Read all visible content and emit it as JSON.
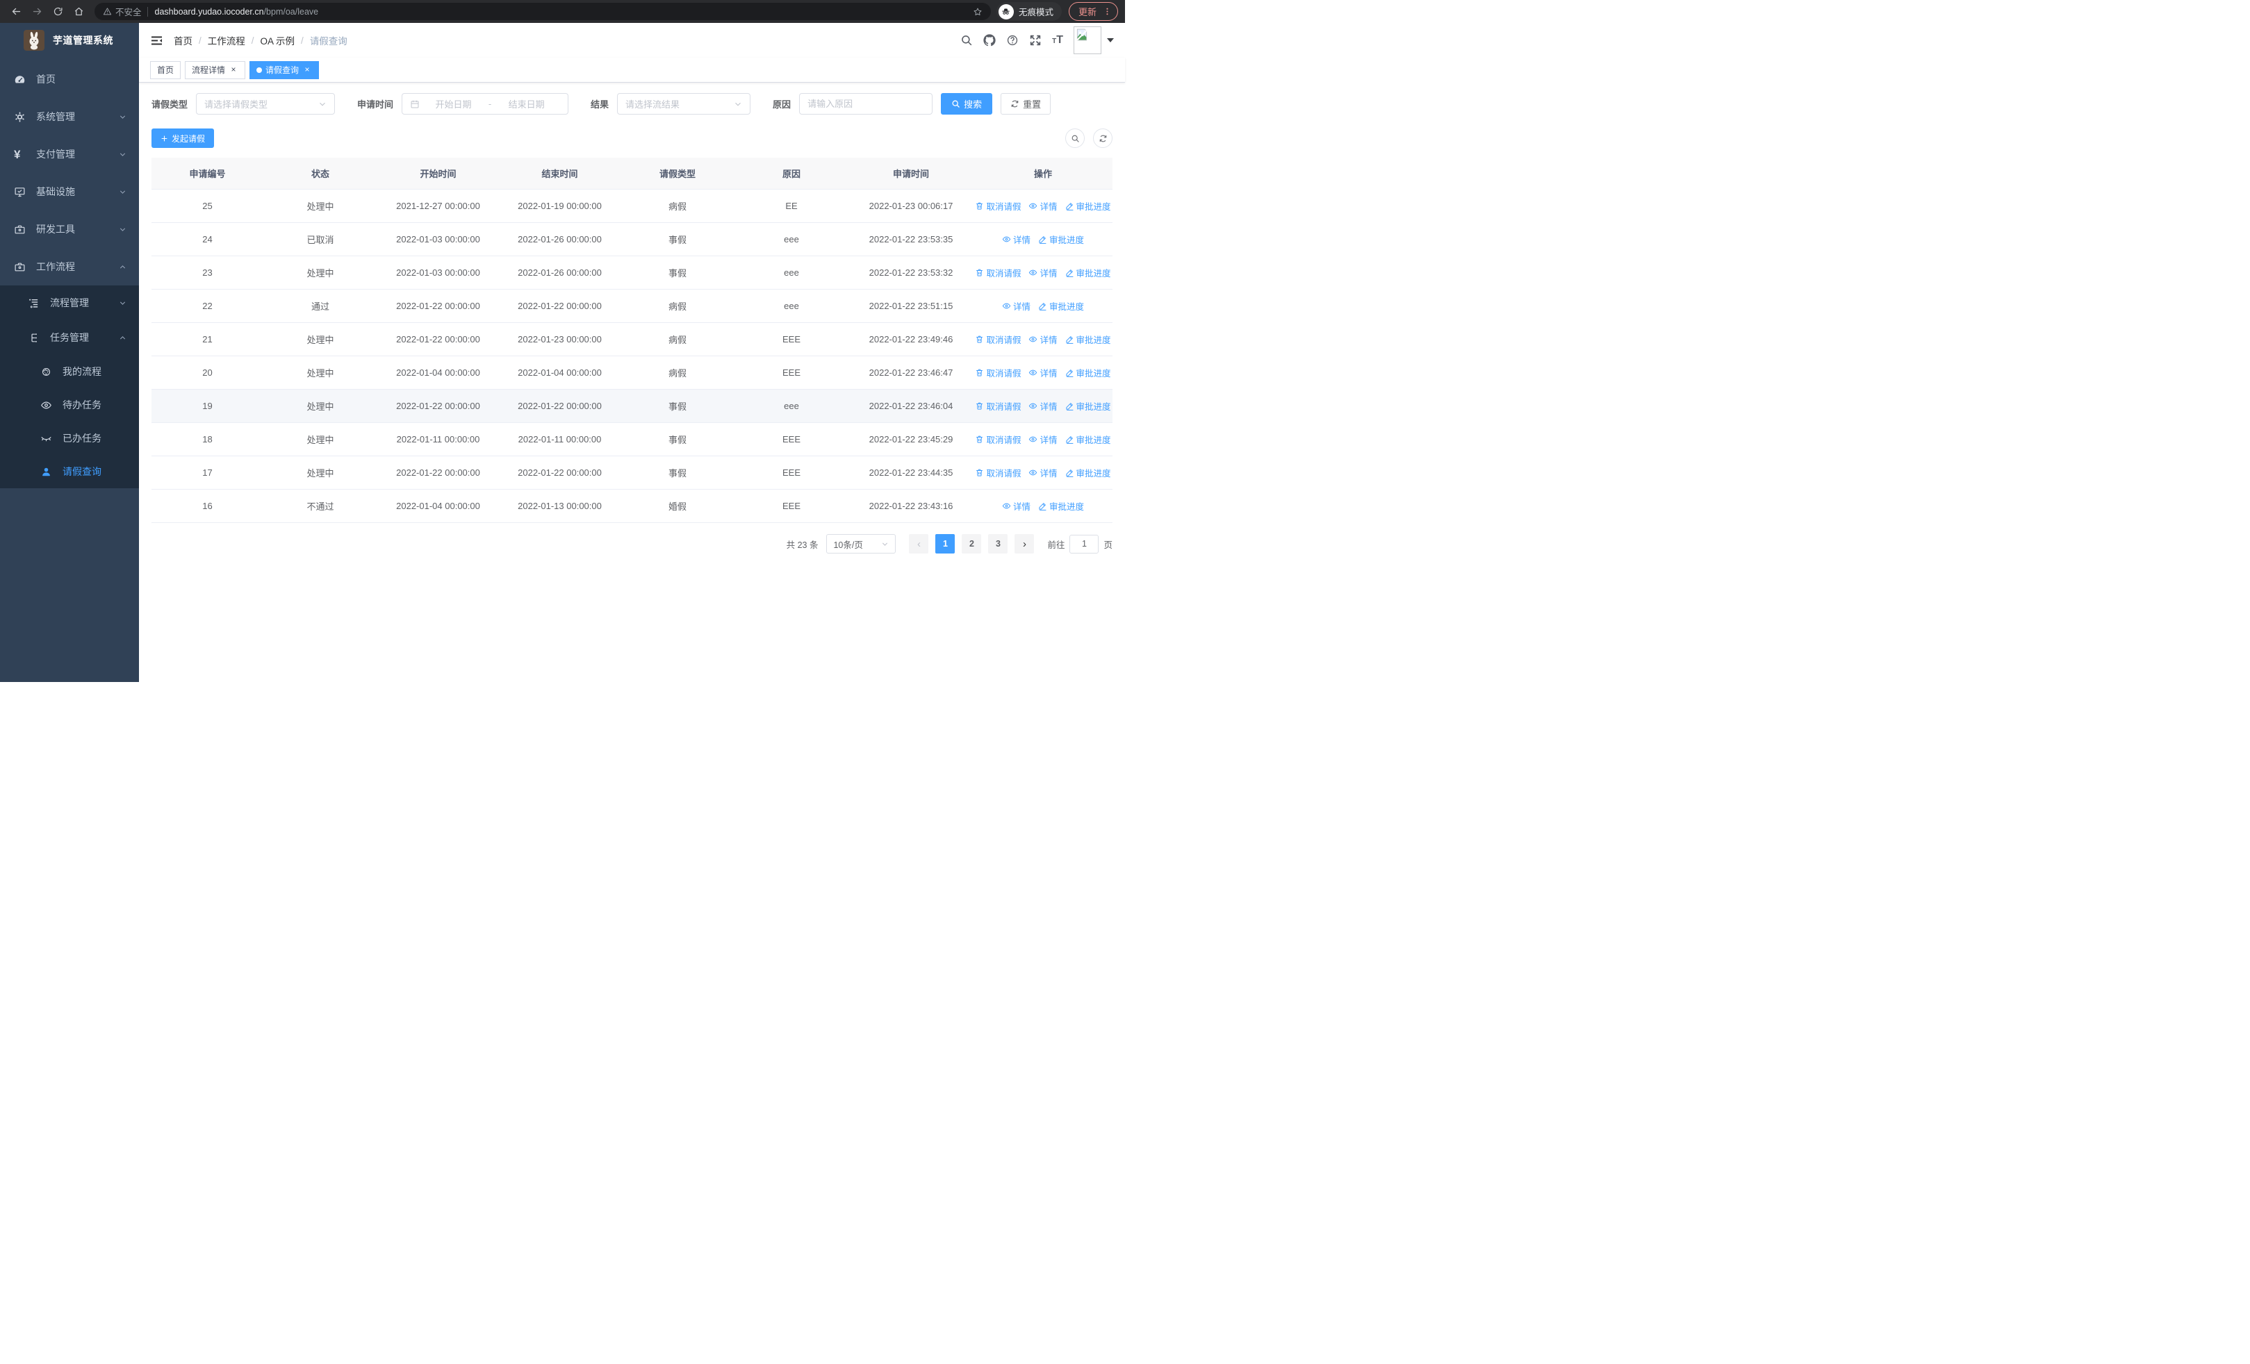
{
  "browser": {
    "security_label": "不安全",
    "url_host": "dashboard.yudao.iocoder.cn",
    "url_path": "/bpm/oa/leave",
    "incognito_label": "无痕模式",
    "update_label": "更新"
  },
  "sidebar": {
    "title": "芋道管理系统",
    "items": [
      {
        "label": "首页"
      },
      {
        "label": "系统管理"
      },
      {
        "label": "支付管理"
      },
      {
        "label": "基础设施"
      },
      {
        "label": "研发工具"
      },
      {
        "label": "工作流程"
      },
      {
        "label": "流程管理"
      },
      {
        "label": "任务管理"
      },
      {
        "label": "我的流程"
      },
      {
        "label": "待办任务"
      },
      {
        "label": "已办任务"
      },
      {
        "label": "请假查询"
      }
    ]
  },
  "navbar": {
    "breadcrumb": [
      "首页",
      "工作流程",
      "OA 示例",
      "请假查询"
    ]
  },
  "tabs": [
    {
      "label": "首页",
      "closable": false,
      "active": false
    },
    {
      "label": "流程详情",
      "closable": true,
      "active": false
    },
    {
      "label": "请假查询",
      "closable": true,
      "active": true
    }
  ],
  "filters": {
    "type_label": "请假类型",
    "type_placeholder": "请选择请假类型",
    "time_label": "申请时间",
    "time_start_placeholder": "开始日期",
    "time_separator": "-",
    "time_end_placeholder": "结束日期",
    "result_label": "结果",
    "result_placeholder": "请选择流结果",
    "reason_label": "原因",
    "reason_placeholder": "请输入原因",
    "search_label": "搜索",
    "reset_label": "重置"
  },
  "toolbar": {
    "create_label": "发起请假"
  },
  "table": {
    "columns": [
      "申请编号",
      "状态",
      "开始时间",
      "结束时间",
      "请假类型",
      "原因",
      "申请时间",
      "操作"
    ],
    "action_labels": {
      "cancel": "取消请假",
      "detail": "详情",
      "progress": "审批进度"
    },
    "action_icons": {
      "cancel": "trash-icon",
      "detail": "eye-icon",
      "progress": "edit-icon"
    },
    "rows": [
      {
        "id": "25",
        "status": "处理中",
        "start": "2021-12-27 00:00:00",
        "end": "2022-01-19 00:00:00",
        "type": "病假",
        "reason": "EE",
        "applyTime": "2022-01-23 00:06:17",
        "actions": [
          "cancel",
          "detail",
          "progress"
        ]
      },
      {
        "id": "24",
        "status": "已取消",
        "start": "2022-01-03 00:00:00",
        "end": "2022-01-26 00:00:00",
        "type": "事假",
        "reason": "eee",
        "applyTime": "2022-01-22 23:53:35",
        "actions": [
          "detail",
          "progress"
        ]
      },
      {
        "id": "23",
        "status": "处理中",
        "start": "2022-01-03 00:00:00",
        "end": "2022-01-26 00:00:00",
        "type": "事假",
        "reason": "eee",
        "applyTime": "2022-01-22 23:53:32",
        "actions": [
          "cancel",
          "detail",
          "progress"
        ]
      },
      {
        "id": "22",
        "status": "通过",
        "start": "2022-01-22 00:00:00",
        "end": "2022-01-22 00:00:00",
        "type": "病假",
        "reason": "eee",
        "applyTime": "2022-01-22 23:51:15",
        "actions": [
          "detail",
          "progress"
        ]
      },
      {
        "id": "21",
        "status": "处理中",
        "start": "2022-01-22 00:00:00",
        "end": "2022-01-23 00:00:00",
        "type": "病假",
        "reason": "EEE",
        "applyTime": "2022-01-22 23:49:46",
        "actions": [
          "cancel",
          "detail",
          "progress"
        ]
      },
      {
        "id": "20",
        "status": "处理中",
        "start": "2022-01-04 00:00:00",
        "end": "2022-01-04 00:00:00",
        "type": "病假",
        "reason": "EEE",
        "applyTime": "2022-01-22 23:46:47",
        "actions": [
          "cancel",
          "detail",
          "progress"
        ]
      },
      {
        "id": "19",
        "status": "处理中",
        "start": "2022-01-22 00:00:00",
        "end": "2022-01-22 00:00:00",
        "type": "事假",
        "reason": "eee",
        "applyTime": "2022-01-22 23:46:04",
        "actions": [
          "cancel",
          "detail",
          "progress"
        ],
        "hover": true
      },
      {
        "id": "18",
        "status": "处理中",
        "start": "2022-01-11 00:00:00",
        "end": "2022-01-11 00:00:00",
        "type": "事假",
        "reason": "EEE",
        "applyTime": "2022-01-22 23:45:29",
        "actions": [
          "cancel",
          "detail",
          "progress"
        ]
      },
      {
        "id": "17",
        "status": "处理中",
        "start": "2022-01-22 00:00:00",
        "end": "2022-01-22 00:00:00",
        "type": "事假",
        "reason": "EEE",
        "applyTime": "2022-01-22 23:44:35",
        "actions": [
          "cancel",
          "detail",
          "progress"
        ]
      },
      {
        "id": "16",
        "status": "不通过",
        "start": "2022-01-04 00:00:00",
        "end": "2022-01-13 00:00:00",
        "type": "婚假",
        "reason": "EEE",
        "applyTime": "2022-01-22 23:43:16",
        "actions": [
          "detail",
          "progress"
        ]
      }
    ]
  },
  "pagination": {
    "total_label": "共 23 条",
    "page_size": "10条/页",
    "pages": [
      "1",
      "2",
      "3"
    ],
    "active_page": "1",
    "goto_label": "前往",
    "goto_value": "1",
    "page_unit": "页"
  },
  "colors": {
    "primary": "#409eff",
    "sidebar_bg": "#304156",
    "submenu_bg": "#1f2d3d",
    "sidebar_text": "#bfcbd9",
    "table_header_bg": "#f8f8f9",
    "hover_row_bg": "#f5f7fa",
    "update_accent": "#ec928e"
  }
}
